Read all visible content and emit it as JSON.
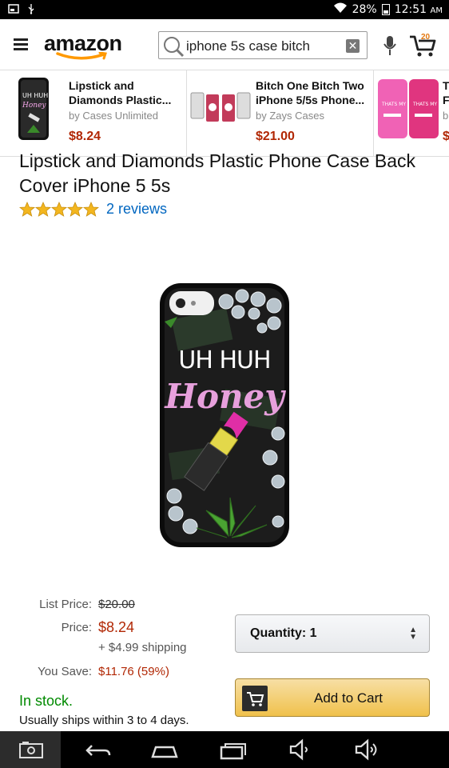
{
  "status_bar": {
    "battery": "28%",
    "time": "12:51",
    "ampm": "AM"
  },
  "header": {
    "logo": "amazon",
    "search": {
      "value": "iphone 5s case bitch"
    },
    "cart_count": "20"
  },
  "sponsored": [
    {
      "title_line1": "Lipstick and",
      "title_line2": "Diamonds Plastic...",
      "by": "by Cases Unlimited",
      "price": "$8.24"
    },
    {
      "title_line1": "Bitch One Bitch Two",
      "title_line2": "iPhone 5/5s Phone...",
      "by": "by Zays Cases",
      "price": "$21.00"
    },
    {
      "title_line1": "T",
      "title_line2": "F",
      "by": "b",
      "price": "$"
    }
  ],
  "product": {
    "title": "Lipstick and Diamonds Plastic Phone Case Back Cover iPhone 5 5s",
    "rating": 5,
    "reviews": "2 reviews",
    "image_text_top": "UH HUH",
    "image_text_script": "Honey"
  },
  "pricing": {
    "list_label": "List Price:",
    "list_value": "$20.00",
    "price_label": "Price:",
    "price_value": "$8.24",
    "shipping": "+ $4.99 shipping",
    "save_label": "You Save:",
    "save_value": "$11.76 (59%)"
  },
  "purchase": {
    "quantity_label": "Quantity: 1",
    "add_to_cart": "Add to Cart",
    "stock": "In stock.",
    "ships": "Usually ships within 3 to 4 days."
  },
  "colors": {
    "price_red": "#b12704",
    "link_blue": "#0066c0",
    "stock_green": "#008a00",
    "cart_yellow": "#f0c14b",
    "brand_orange": "#ff9900"
  }
}
